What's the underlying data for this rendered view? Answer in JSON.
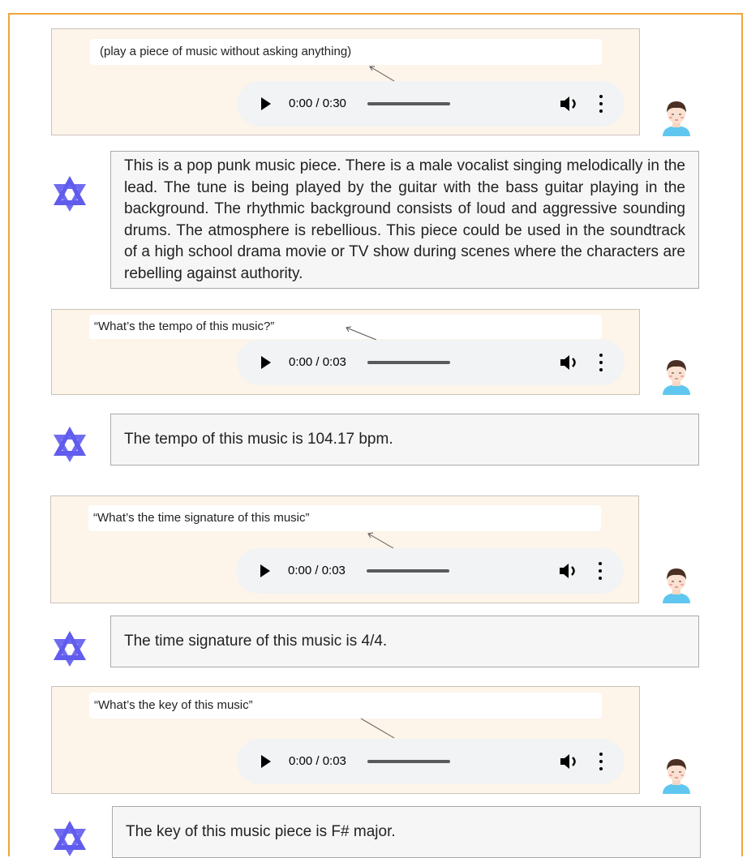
{
  "blocks": [
    {
      "user_caption": "(play a piece of music without asking anything)",
      "player_time": "0:00 / 0:30",
      "bot_response": "This is a pop punk music piece. There is a male vocalist singing melodically in the lead. The tune is being played by the guitar with the bass guitar playing in the background. The rhythmic background consists of loud and aggressive sounding drums. The atmosphere is rebellious. This piece could be used in the soundtrack of a high school drama movie or TV show during scenes where the characters are rebelling against authority."
    },
    {
      "user_caption": "“What’s the tempo of this music?”",
      "player_time": "0:00 / 0:03",
      "bot_response": "The tempo of this music is 104.17 bpm."
    },
    {
      "user_caption": "“What’s the time signature of this music”",
      "player_time": "0:00 / 0:03",
      "bot_response": "The time signature of this music is 4/4."
    },
    {
      "user_caption": "“What’s the key of this music”",
      "player_time": "0:00 / 0:03",
      "bot_response": "The key of this music piece is F# major."
    }
  ],
  "colors": {
    "frame_border": "#f0a53a",
    "user_panel_bg": "#fdf4ea",
    "bot_logo": "#615ced",
    "player_bg": "#f1f3f4"
  },
  "icons": {
    "play": "play-icon",
    "volume": "volume-icon",
    "more": "more-vert-icon",
    "user_avatar": "user-avatar-icon",
    "bot_logo": "bot-logo-icon"
  }
}
